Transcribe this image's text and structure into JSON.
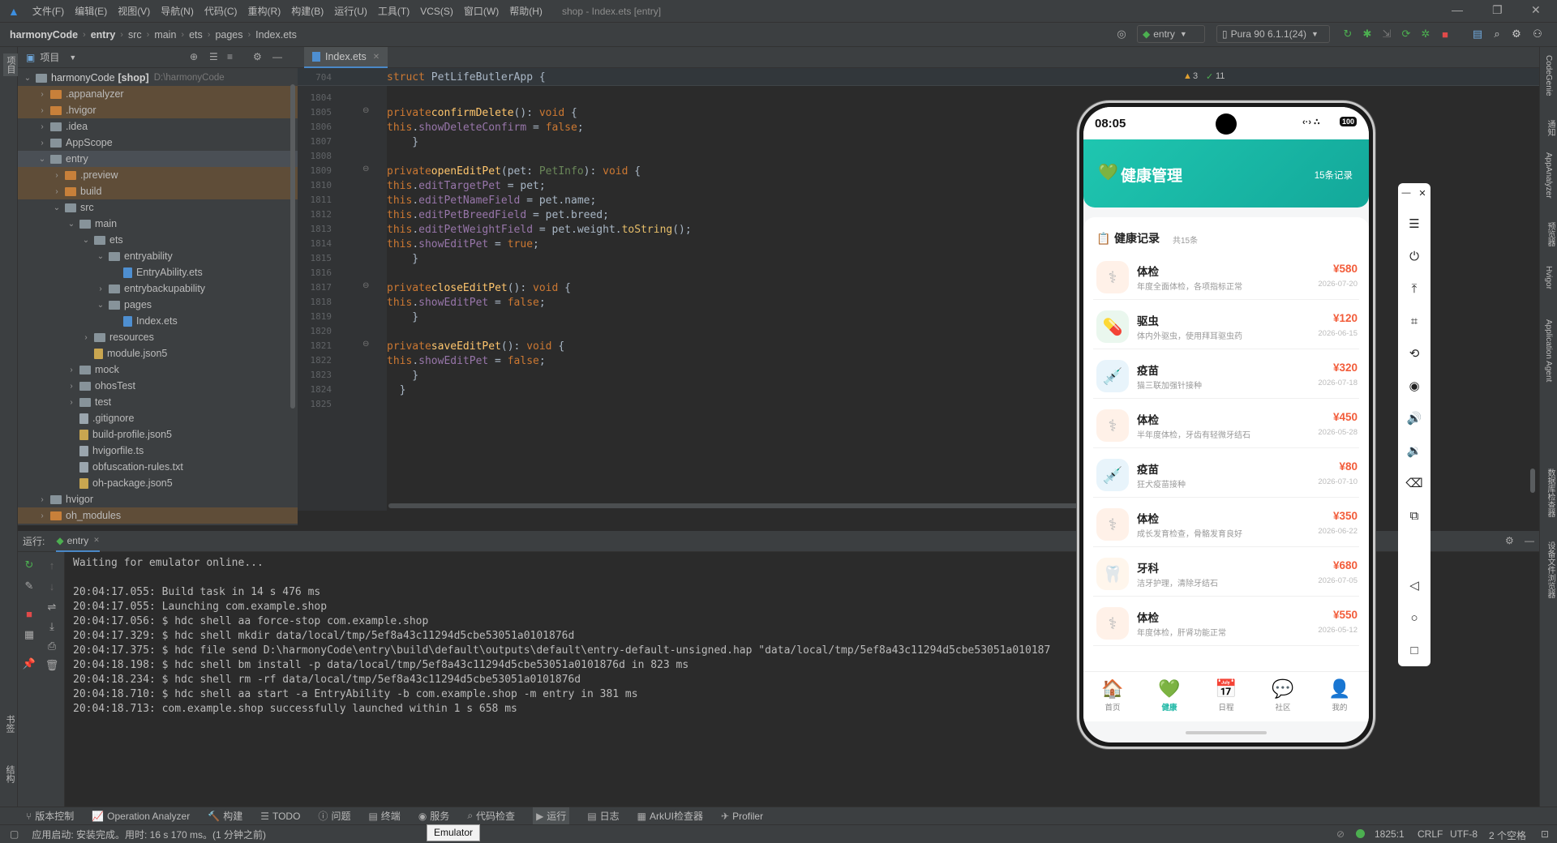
{
  "menu": [
    "文件(F)",
    "编辑(E)",
    "视图(V)",
    "导航(N)",
    "代码(C)",
    "重构(R)",
    "构建(B)",
    "运行(U)",
    "工具(T)",
    "VCS(S)",
    "窗口(W)",
    "帮助(H)"
  ],
  "window_title": "shop - Index.ets [entry]",
  "breadcrumb": [
    "harmonyCode",
    "entry",
    "src",
    "main",
    "ets",
    "pages",
    "Index.ets"
  ],
  "toolbar": {
    "run_config": "entry",
    "device": "Pura 90 6.1.1(24)"
  },
  "project": {
    "header": "项目",
    "root_name": "harmonyCode",
    "root_module": "[shop]",
    "root_path": "D:\\harmonyCode",
    "items": [
      {
        "label": ".appanalyzer",
        "type": "folder-orange",
        "depth": 1,
        "arrow": "›",
        "hl": "ex"
      },
      {
        "label": ".hvigor",
        "type": "folder-orange",
        "depth": 1,
        "arrow": "›",
        "hl": "ex"
      },
      {
        "label": ".idea",
        "type": "folder",
        "depth": 1,
        "arrow": "›",
        "hl": ""
      },
      {
        "label": "AppScope",
        "type": "folder",
        "depth": 1,
        "arrow": "›",
        "hl": ""
      },
      {
        "label": "entry",
        "type": "folder",
        "depth": 1,
        "arrow": "⌄",
        "hl": "sel"
      },
      {
        "label": ".preview",
        "type": "folder-orange",
        "depth": 2,
        "arrow": "›",
        "hl": "ex"
      },
      {
        "label": "build",
        "type": "folder-orange",
        "depth": 2,
        "arrow": "›",
        "hl": "ex"
      },
      {
        "label": "src",
        "type": "folder",
        "depth": 2,
        "arrow": "⌄",
        "hl": ""
      },
      {
        "label": "main",
        "type": "folder",
        "depth": 3,
        "arrow": "⌄",
        "hl": ""
      },
      {
        "label": "ets",
        "type": "folder",
        "depth": 4,
        "arrow": "⌄",
        "hl": ""
      },
      {
        "label": "entryability",
        "type": "folder",
        "depth": 5,
        "arrow": "⌄",
        "hl": ""
      },
      {
        "label": "EntryAbility.ets",
        "type": "file-ets",
        "depth": 6,
        "arrow": "",
        "hl": ""
      },
      {
        "label": "entrybackupability",
        "type": "folder",
        "depth": 5,
        "arrow": "›",
        "hl": ""
      },
      {
        "label": "pages",
        "type": "folder",
        "depth": 5,
        "arrow": "⌄",
        "hl": ""
      },
      {
        "label": "Index.ets",
        "type": "file-ets",
        "depth": 6,
        "arrow": "",
        "hl": ""
      },
      {
        "label": "resources",
        "type": "folder",
        "depth": 4,
        "arrow": "›",
        "hl": ""
      },
      {
        "label": "module.json5",
        "type": "file-json",
        "depth": 4,
        "arrow": "",
        "hl": ""
      },
      {
        "label": "mock",
        "type": "folder",
        "depth": 3,
        "arrow": "›",
        "hl": ""
      },
      {
        "label": "ohosTest",
        "type": "folder",
        "depth": 3,
        "arrow": "›",
        "hl": ""
      },
      {
        "label": "test",
        "type": "folder",
        "depth": 3,
        "arrow": "›",
        "hl": ""
      },
      {
        "label": ".gitignore",
        "type": "file",
        "depth": 3,
        "arrow": "",
        "hl": ""
      },
      {
        "label": "build-profile.json5",
        "type": "file-json",
        "depth": 3,
        "arrow": "",
        "hl": ""
      },
      {
        "label": "hvigorfile.ts",
        "type": "file",
        "depth": 3,
        "arrow": "",
        "hl": ""
      },
      {
        "label": "obfuscation-rules.txt",
        "type": "file",
        "depth": 3,
        "arrow": "",
        "hl": ""
      },
      {
        "label": "oh-package.json5",
        "type": "file-json",
        "depth": 3,
        "arrow": "",
        "hl": ""
      },
      {
        "label": "hvigor",
        "type": "folder",
        "depth": 1,
        "arrow": "›",
        "hl": ""
      },
      {
        "label": "oh_modules",
        "type": "folder-orange",
        "depth": 1,
        "arrow": "›",
        "hl": "ex"
      }
    ]
  },
  "editor": {
    "tab": "Index.ets",
    "sticky_line": "704",
    "sticky_text": "struct PetLifeButlerApp {",
    "inspections": {
      "warnings": "3",
      "ok": "11"
    },
    "lines": [
      {
        "n": "1804",
        "t": ""
      },
      {
        "n": "1805",
        "t": "    private confirmDelete(): void {"
      },
      {
        "n": "1806",
        "t": "      this.showDeleteConfirm = false;"
      },
      {
        "n": "1807",
        "t": "    }"
      },
      {
        "n": "1808",
        "t": ""
      },
      {
        "n": "1809",
        "t": "    private openEditPet(pet: PetInfo): void {"
      },
      {
        "n": "1810",
        "t": "      this.editTargetPet = pet;"
      },
      {
        "n": "1811",
        "t": "      this.editPetNameField = pet.name;"
      },
      {
        "n": "1812",
        "t": "      this.editPetBreedField = pet.breed;"
      },
      {
        "n": "1813",
        "t": "      this.editPetWeightField = pet.weight.toString();"
      },
      {
        "n": "1814",
        "t": "      this.showEditPet = true;"
      },
      {
        "n": "1815",
        "t": "    }"
      },
      {
        "n": "1816",
        "t": ""
      },
      {
        "n": "1817",
        "t": "    private closeEditPet(): void {"
      },
      {
        "n": "1818",
        "t": "      this.showEditPet = false;"
      },
      {
        "n": "1819",
        "t": "    }"
      },
      {
        "n": "1820",
        "t": ""
      },
      {
        "n": "1821",
        "t": "    private saveEditPet(): void {"
      },
      {
        "n": "1822",
        "t": "      this.showEditPet = false;"
      },
      {
        "n": "1823",
        "t": "    }"
      },
      {
        "n": "1824",
        "t": "  }"
      },
      {
        "n": "1825",
        "t": ""
      }
    ]
  },
  "run": {
    "label": "运行:",
    "tab": "entry",
    "console": [
      "Waiting for emulator online...",
      "",
      "20:04:17.055: Build task in 14 s 476 ms",
      "20:04:17.055: Launching com.example.shop",
      "20:04:17.056: $ hdc shell aa force-stop com.example.shop",
      "20:04:17.329: $ hdc shell mkdir data/local/tmp/5ef8a43c11294d5cbe53051a0101876d",
      "20:04:17.375: $ hdc file send D:\\harmonyCode\\entry\\build\\default\\outputs\\default\\entry-default-unsigned.hap \"data/local/tmp/5ef8a43c11294d5cbe53051a010187",
      "20:04:18.198: $ hdc shell bm install -p data/local/tmp/5ef8a43c11294d5cbe53051a0101876d in 823 ms",
      "20:04:18.234: $ hdc shell rm -rf data/local/tmp/5ef8a43c11294d5cbe53051a0101876d",
      "20:04:18.710: $ hdc shell aa start -a EntryAbility -b com.example.shop -m entry in 381 ms",
      "20:04:18.713: com.example.shop successfully launched within 1 s 658 ms"
    ]
  },
  "tool_windows": [
    "版本控制",
    "Operation Analyzer",
    "构建",
    "TODO",
    "问题",
    "终端",
    "服务",
    "代码检查",
    "运行",
    "日志",
    "ArkUI检查器",
    "Profiler"
  ],
  "status": {
    "message": "应用启动: 安装完成。用时: 16 s 170 ms。(1 分钟之前)",
    "tooltip": "Emulator",
    "position": "1825:1",
    "line_sep": "CRLF",
    "encoding": "UTF-8",
    "indent": "2 个空格"
  },
  "left_strip": [
    "项目",
    "书签",
    "结构"
  ],
  "right_strip": [
    "CodeGenie",
    "通知",
    "AppAnalyzer",
    "预览器",
    "Hvigor",
    "Application Agent",
    "数据库检查器",
    "设备文件浏览器"
  ],
  "phone": {
    "time": "08:05",
    "battery": "100",
    "header_title": "健康管理",
    "header_count": "15条记录",
    "section_title": "健康记录",
    "section_count": "共15条",
    "records": [
      {
        "icon": "stethoscope-icon",
        "glyph": "⚕",
        "bg": "#fff1e8",
        "title": "体检",
        "desc": "年度全面体检，各项指标正常",
        "price": "¥580",
        "date": "2026-07-20"
      },
      {
        "icon": "pill-icon",
        "glyph": "💊",
        "bg": "#eaf7ee",
        "title": "驱虫",
        "desc": "体内外驱虫，使用拜耳驱虫药",
        "price": "¥120",
        "date": "2026-06-15"
      },
      {
        "icon": "syringe-icon",
        "glyph": "💉",
        "bg": "#e8f4fb",
        "title": "疫苗",
        "desc": "猫三联加强针接种",
        "price": "¥320",
        "date": "2026-07-18"
      },
      {
        "icon": "stethoscope-icon",
        "glyph": "⚕",
        "bg": "#fff1e8",
        "title": "体检",
        "desc": "半年度体检，牙齿有轻微牙结石",
        "price": "¥450",
        "date": "2026-05-28"
      },
      {
        "icon": "syringe-icon",
        "glyph": "💉",
        "bg": "#e8f4fb",
        "title": "疫苗",
        "desc": "狂犬疫苗接种",
        "price": "¥80",
        "date": "2026-07-10"
      },
      {
        "icon": "stethoscope-icon",
        "glyph": "⚕",
        "bg": "#fff1e8",
        "title": "体检",
        "desc": "成长发育检查，骨骼发育良好",
        "price": "¥350",
        "date": "2026-06-22"
      },
      {
        "icon": "tooth-icon",
        "glyph": "🦷",
        "bg": "#fff6ec",
        "title": "牙科",
        "desc": "洁牙护理，清除牙结石",
        "price": "¥680",
        "date": "2026-07-05"
      },
      {
        "icon": "stethoscope-icon",
        "glyph": "⚕",
        "bg": "#fff1e8",
        "title": "体检",
        "desc": "年度体检，肝肾功能正常",
        "price": "¥550",
        "date": "2026-05-12"
      }
    ],
    "nav": [
      {
        "label": "首页",
        "glyph": "🏠",
        "active": false
      },
      {
        "label": "健康",
        "glyph": "💚",
        "active": true
      },
      {
        "label": "日程",
        "glyph": "📅",
        "active": false
      },
      {
        "label": "社区",
        "glyph": "💬",
        "active": false
      },
      {
        "label": "我的",
        "glyph": "👤",
        "active": false
      }
    ],
    "accent": "#1fb8a6"
  }
}
